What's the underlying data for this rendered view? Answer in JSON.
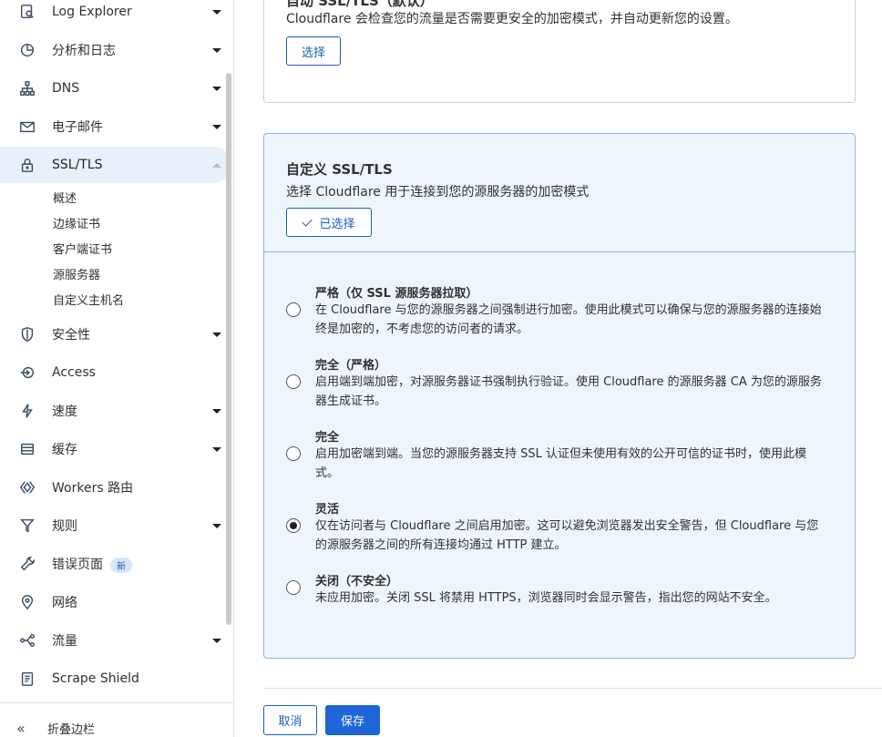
{
  "sidebar": {
    "items": [
      {
        "label": "Log Explorer",
        "icon": "document-search-icon",
        "expandable": true
      },
      {
        "label": "分析和日志",
        "icon": "pie-chart-icon",
        "expandable": true
      },
      {
        "label": "DNS",
        "icon": "network-tree-icon",
        "expandable": true
      },
      {
        "label": "电子邮件",
        "icon": "envelope-icon",
        "expandable": true
      },
      {
        "label": "SSL/TLS",
        "icon": "lock-icon",
        "expandable": true,
        "expanded": true
      },
      {
        "label": "安全性",
        "icon": "shield-icon",
        "expandable": true
      },
      {
        "label": "Access",
        "icon": "access-icon",
        "expandable": false
      },
      {
        "label": "速度",
        "icon": "lightning-icon",
        "expandable": true
      },
      {
        "label": "缓存",
        "icon": "storage-icon",
        "expandable": true
      },
      {
        "label": "Workers 路由",
        "icon": "workers-icon",
        "expandable": false
      },
      {
        "label": "规则",
        "icon": "funnel-icon",
        "expandable": true
      },
      {
        "label": "错误页面",
        "icon": "wrench-icon",
        "expandable": false,
        "badge": "新"
      },
      {
        "label": "网络",
        "icon": "location-pin-icon",
        "expandable": false
      },
      {
        "label": "流量",
        "icon": "traffic-icon",
        "expandable": true
      },
      {
        "label": "Scrape Shield",
        "icon": "clipboard-icon",
        "expandable": false
      }
    ],
    "ssl_subitems": [
      "概述",
      "边缘证书",
      "客户端证书",
      "源服务器",
      "自定义主机名"
    ],
    "collapse_label": "折叠边栏"
  },
  "auto_card": {
    "title": "自动 SSL/TLS（默认）",
    "description": "Cloudflare 会检查您的流量是否需要更安全的加密模式，并自动更新您的设置。",
    "select_label": "选择"
  },
  "custom_card": {
    "title": "自定义 SSL/TLS",
    "description": "选择 Cloudflare 用于连接到您的源服务器的加密模式",
    "selected_label": "已选择",
    "options": [
      {
        "title": "严格（仅 SSL 源服务器拉取）",
        "description": "在 Cloudflare 与您的源服务器之间强制进行加密。使用此模式可以确保与您的源服务器的连接始终是加密的，不考虑您的访问者的请求。",
        "checked": false
      },
      {
        "title": "完全（严格）",
        "description": "启用端到端加密，对源服务器证书强制执行验证。使用 Cloudflare 的源服务器 CA 为您的源服务器生成证书。",
        "checked": false
      },
      {
        "title": "完全",
        "description": "启用加密端到端。当您的源服务器支持 SSL 认证但未使用有效的公开可信的证书时，使用此模式。",
        "checked": false
      },
      {
        "title": "灵活",
        "description": "仅在访问者与 Cloudflare 之间启用加密。这可以避免浏览器发出安全警告，但 Cloudflare 与您的源服务器之间的所有连接均通过 HTTP 建立。",
        "checked": true
      },
      {
        "title": "关闭（不安全）",
        "description": "未应用加密。关闭 SSL 将禁用 HTTPS，浏览器同时会显示警告，指出您的网站不安全。",
        "checked": false
      }
    ]
  },
  "footer": {
    "cancel_label": "取消",
    "save_label": "保存"
  },
  "colors": {
    "accent": "#1e5eb7",
    "primary_button": "#1e66d8",
    "selected_card_bg": "#eef5fd",
    "active_nav_bg": "#e8f1fb"
  }
}
